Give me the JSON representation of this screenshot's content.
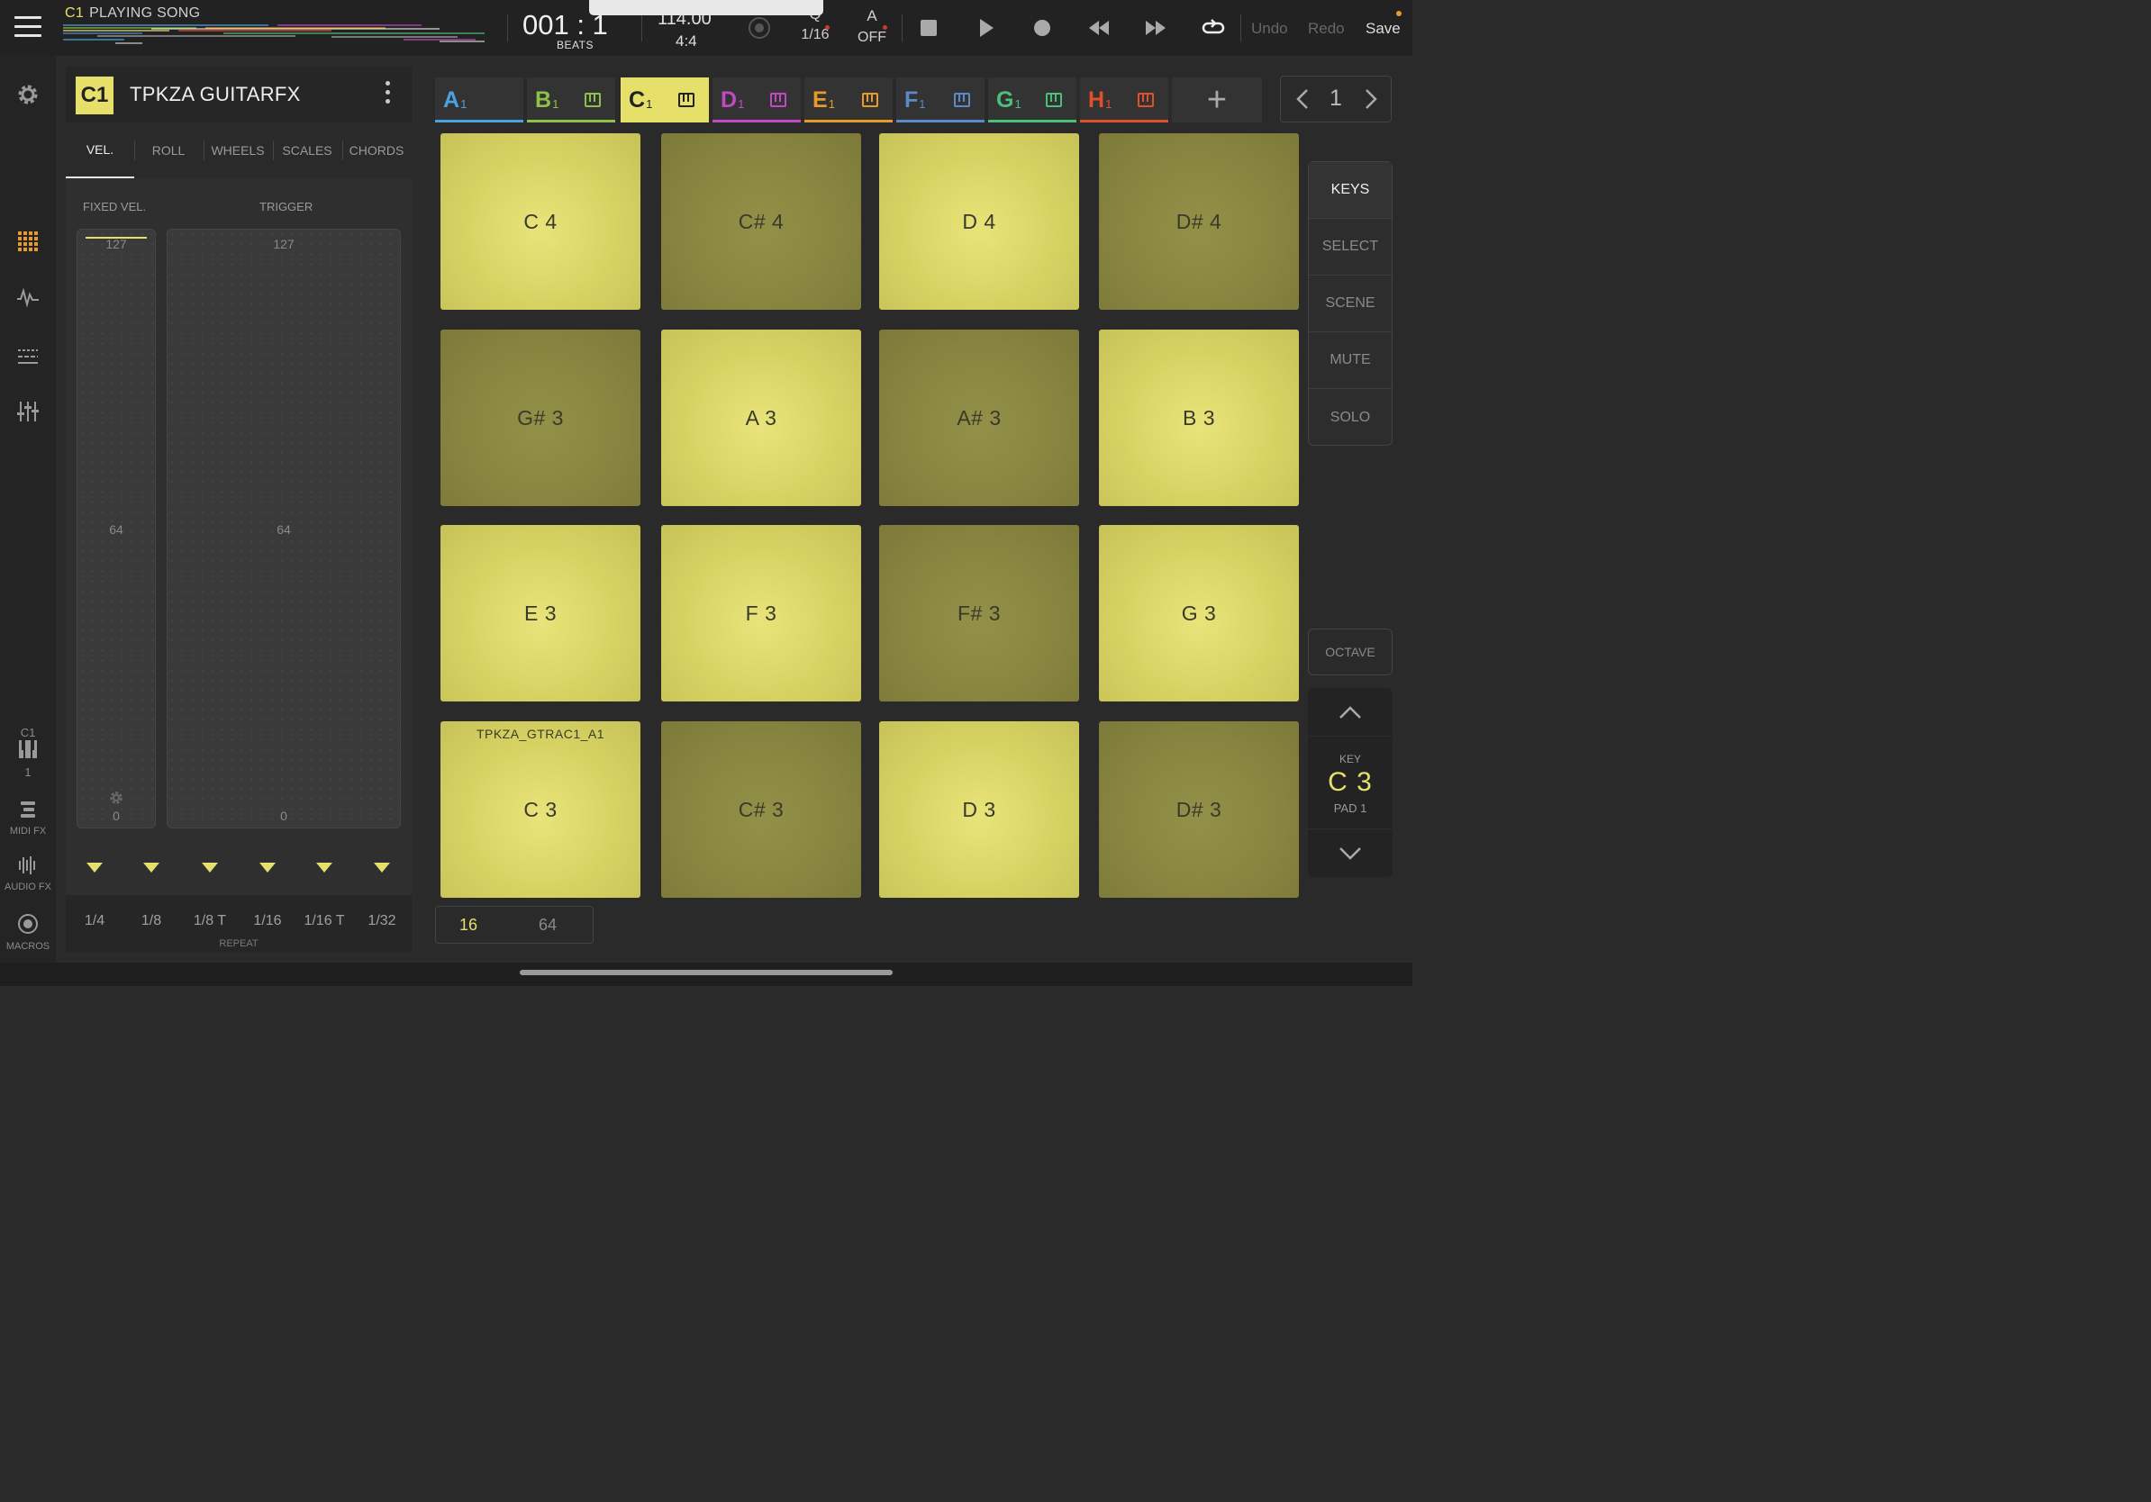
{
  "topbar": {
    "track_badge": "C1",
    "song_status": "PLAYING SONG",
    "position": "001 : 1",
    "position_unit": "BEATS",
    "tempo": "114.00",
    "time_signature": "4:4",
    "quantize_label": "Q",
    "quantize_value": "1/16",
    "automation_label": "A",
    "automation_value": "OFF",
    "undo": "Undo",
    "redo": "Redo",
    "save": "Save"
  },
  "leftnav": {
    "instrument_track": "C1",
    "instrument_num": "1",
    "midi_fx": "MIDI FX",
    "audio_fx": "AUDIO FX",
    "macros": "MACROS"
  },
  "panel": {
    "track_badge": "C1",
    "track_name": "TPKZA GUITARFX",
    "tabs": [
      "VEL.",
      "ROLL",
      "WHEELS",
      "SCALES",
      "CHORDS"
    ],
    "fixed_vel_label": "FIXED VEL.",
    "trigger_label": "TRIGGER",
    "fixed_vel": {
      "max": "127",
      "mid": "64",
      "min": "0"
    },
    "trigger": {
      "max": "127",
      "mid": "64",
      "min": "0"
    },
    "repeat_values": [
      "1/4",
      "1/8",
      "1/8 T",
      "1/16",
      "1/16 T",
      "1/32"
    ],
    "repeat_label": "REPEAT"
  },
  "track_tabs": [
    {
      "letter": "A",
      "num": "1",
      "color": "#4aa3e0",
      "has_kbd": false
    },
    {
      "letter": "B",
      "num": "1",
      "color": "#8fc04a",
      "has_kbd": true
    },
    {
      "letter": "C",
      "num": "1",
      "color": "#e6e06a",
      "has_kbd": true,
      "active": true
    },
    {
      "letter": "D",
      "num": "1",
      "color": "#c04ac0",
      "has_kbd": true
    },
    {
      "letter": "E",
      "num": "1",
      "color": "#e89a2a",
      "has_kbd": true
    },
    {
      "letter": "F",
      "num": "1",
      "color": "#5a8ac8",
      "has_kbd": true
    },
    {
      "letter": "G",
      "num": "1",
      "color": "#4ac07a",
      "has_kbd": true
    },
    {
      "letter": "H",
      "num": "1",
      "color": "#e0502a",
      "has_kbd": true
    }
  ],
  "pager": {
    "page": "1"
  },
  "pads": [
    {
      "note": "C 4",
      "lit": true
    },
    {
      "note": "C# 4",
      "lit": false
    },
    {
      "note": "D 4",
      "lit": true
    },
    {
      "note": "D# 4",
      "lit": false
    },
    {
      "note": "G# 3",
      "lit": false
    },
    {
      "note": "A 3",
      "lit": true
    },
    {
      "note": "A# 3",
      "lit": false
    },
    {
      "note": "B 3",
      "lit": true
    },
    {
      "note": "E 3",
      "lit": true
    },
    {
      "note": "F 3",
      "lit": true
    },
    {
      "note": "F# 3",
      "lit": false
    },
    {
      "note": "G 3",
      "lit": true
    },
    {
      "note": "C 3",
      "lit": true,
      "name": "TPKZA_GTRAC1_A1"
    },
    {
      "note": "C# 3",
      "lit": false
    },
    {
      "note": "D 3",
      "lit": true
    },
    {
      "note": "D# 3",
      "lit": false
    }
  ],
  "side_buttons": [
    "KEYS",
    "SELECT",
    "SCENE",
    "MUTE",
    "SOLO"
  ],
  "octave": {
    "label": "OCTAVE",
    "key_label": "KEY",
    "key_value": "C 3",
    "pad_label": "PAD 1"
  },
  "grid_size": [
    "16",
    "64"
  ],
  "colors": {
    "accent": "#e6e06a",
    "pad_lit": "#d6d262",
    "pad_dim": "#87843f",
    "record": "#d03a2a"
  },
  "icons": [
    "menu-icon",
    "gear-icon",
    "grid-icon",
    "waveform-icon",
    "sequencer-icon",
    "mixer-icon",
    "piano-icon",
    "midi-fx-icon",
    "audio-fx-icon",
    "macros-icon",
    "stop-icon",
    "play-icon",
    "record-icon",
    "rewind-icon",
    "fast-forward-icon",
    "loop-icon",
    "metronome-icon",
    "kebab-icon"
  ]
}
